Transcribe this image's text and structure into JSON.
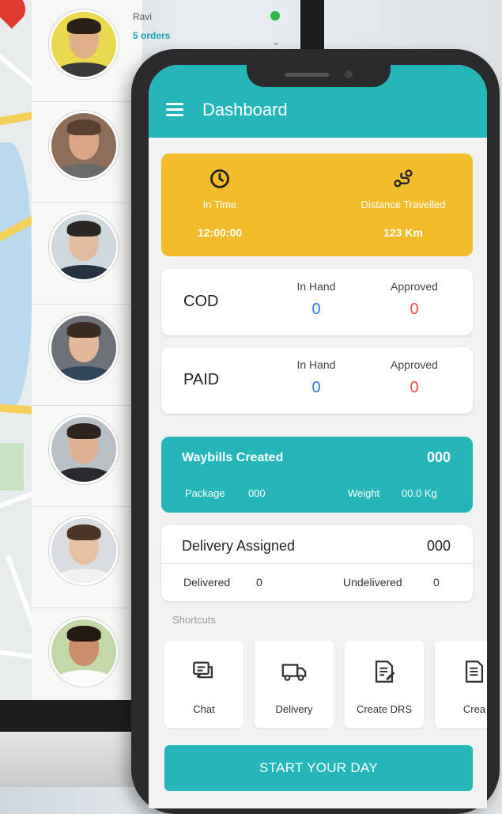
{
  "laptop": {
    "contacts": [
      {
        "name": "Ravi",
        "orders": "5 orders"
      }
    ]
  },
  "app": {
    "title": "Dashboard",
    "icons": {
      "menu": "hamburger-icon"
    }
  },
  "time_card": {
    "in_time_label": "In Time",
    "in_time_value": "12:00:00",
    "distance_label": "Distance Travelled",
    "distance_value": "123 Km"
  },
  "cod": {
    "title": "COD",
    "in_hand_label": "In Hand",
    "in_hand_value": "0",
    "approved_label": "Approved",
    "approved_value": "0"
  },
  "paid": {
    "title": "PAID",
    "in_hand_label": "In Hand",
    "in_hand_value": "0",
    "approved_label": "Approved",
    "approved_value": "0"
  },
  "waybills": {
    "title": "Waybills Created",
    "count": "000",
    "package_label": "Package",
    "package_value": "000",
    "weight_label": "Weight",
    "weight_value": "00.0 Kg"
  },
  "delivery": {
    "title": "Delivery Assigned",
    "count": "000",
    "delivered_label": "Delivered",
    "delivered_value": "0",
    "undelivered_label": "Undelivered",
    "undelivered_value": "0"
  },
  "shortcuts": {
    "label": "Shortcuts",
    "items": [
      {
        "label": "Chat",
        "icon": "chat-icon"
      },
      {
        "label": "Delivery",
        "icon": "truck-icon"
      },
      {
        "label": "Create DRS",
        "icon": "document-edit-icon"
      },
      {
        "label": "Crea",
        "icon": "document-icon"
      }
    ]
  },
  "start_button": "START YOUR DAY",
  "colors": {
    "teal": "#25b6b9",
    "amber": "#f2bc2b",
    "blue_value": "#2e7de0",
    "red_value": "#ef4a4a",
    "online": "#2db84a"
  }
}
